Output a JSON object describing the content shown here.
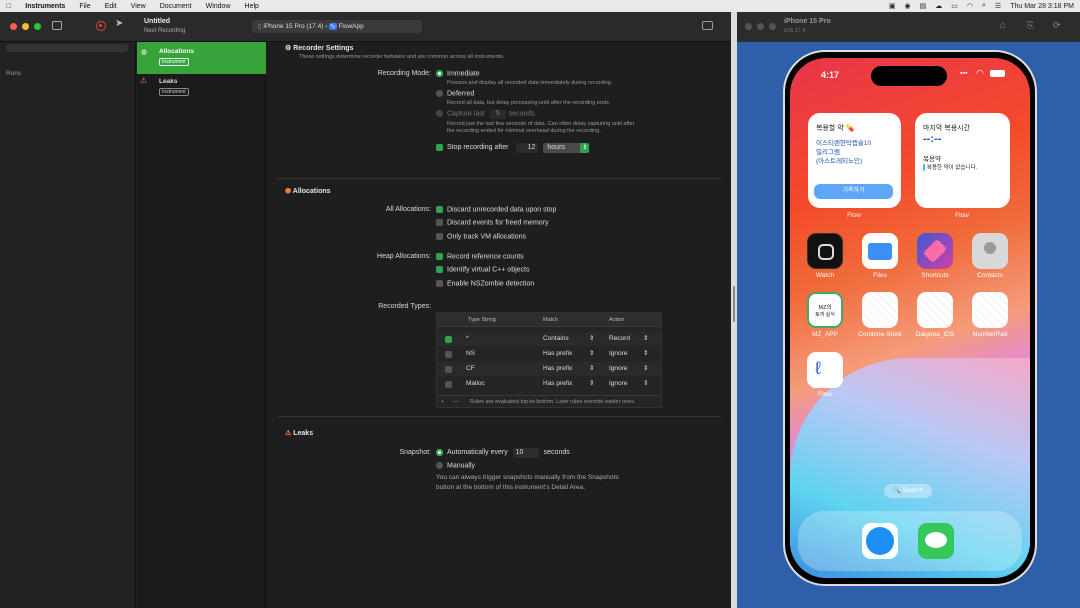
{
  "menubar": {
    "apple": "",
    "items": [
      "Instruments",
      "File",
      "Edit",
      "View",
      "Document",
      "Window",
      "Help"
    ],
    "clock": "Thu Mar 28 3:18 PM"
  },
  "toolbar": {
    "title": "Untitled",
    "subtitle": "Next Recording",
    "device": "iPhone 15 Pro (17.4)",
    "app": "FlowApp"
  },
  "left": {
    "runs_label": "Runs"
  },
  "instruments": [
    {
      "name": "Allocations",
      "tag": "Instrument"
    },
    {
      "name": "Leaks",
      "tag": "Instrument"
    }
  ],
  "recorder": {
    "title": "Recorder Settings",
    "desc": "These settings determine recorder behavior and are common across all instruments.",
    "mode_label": "Recording Mode:",
    "immediate": "Immediate",
    "immediate_desc": "Process and display all recorded data immediately during recording.",
    "deferred": "Deferred",
    "deferred_desc": "Record all data, but delay processing until after the recording ends.",
    "capture_last": "Capture last",
    "capture_value": "5",
    "capture_unit": "seconds",
    "capture_desc1": "Record just the last few seconds of data. Can often delay capturing until after",
    "capture_desc2": "the recording ended for minimal overhead during the recording.",
    "stop_after": "Stop recording after",
    "stop_value": "12",
    "stop_unit": "hours"
  },
  "allocations": {
    "title": "Allocations",
    "all_label": "All Allocations:",
    "discard_unrecorded": "Discard unrecorded data upon stop",
    "discard_freed": "Discard events for freed memory",
    "only_vm": "Only track VM allocations",
    "heap_label": "Heap Allocations:",
    "ref_counts": "Record reference counts",
    "cpp_objects": "Identify virtual C++ objects",
    "nszombie": "Enable NSZombie detection",
    "types_label": "Recorded Types:",
    "table_headers": [
      "Type String",
      "Match",
      "Action"
    ],
    "rows": [
      {
        "type": "*",
        "match": "Contains",
        "action": "Record",
        "on": true
      },
      {
        "type": "NS",
        "match": "Has prefix",
        "action": "Ignore",
        "on": false
      },
      {
        "type": "CF",
        "match": "Has prefix",
        "action": "Ignore",
        "on": false
      },
      {
        "type": "Malloc",
        "match": "Has prefix",
        "action": "Ignore",
        "on": false
      }
    ],
    "footer": "Rules are evaluated top-to-bottom. Later rules override earlier ones."
  },
  "leaks": {
    "title": "Leaks",
    "snapshot_label": "Snapshot:",
    "auto": "Automatically every",
    "auto_value": "10",
    "auto_unit": "seconds",
    "manual": "Manually",
    "manual_desc1": "You can always trigger snapshots manually from the Snapshots",
    "manual_desc2": "button at the bottom of this instrument's Detail Area."
  },
  "simulator": {
    "title": "iPhone 15 Pro",
    "subtitle": "iOS 17.4"
  },
  "phone": {
    "time": "4:17",
    "widget1": {
      "title": "복용할 약 💊",
      "line1": "이스티렌현탁캡슐10",
      "line2": "밀리그램",
      "line3": "(아스트레티노인)",
      "button": "기록하기",
      "caption": "Flow"
    },
    "widget2": {
      "title": "마지막 복용시간",
      "time": "--:--",
      "sub": "복용약",
      "note": "복용한 약이 없습니다.",
      "caption": "Flow"
    },
    "apps": [
      "Watch",
      "Files",
      "Shortcuts",
      "Contacts",
      "MZ_APP",
      "Combine-Store",
      "Daigona_iOS",
      "NumberPad",
      "Flow"
    ],
    "mz_text1": "MZ의",
    "mz_text2": "토끼 실식",
    "search": "🔍 Search"
  }
}
